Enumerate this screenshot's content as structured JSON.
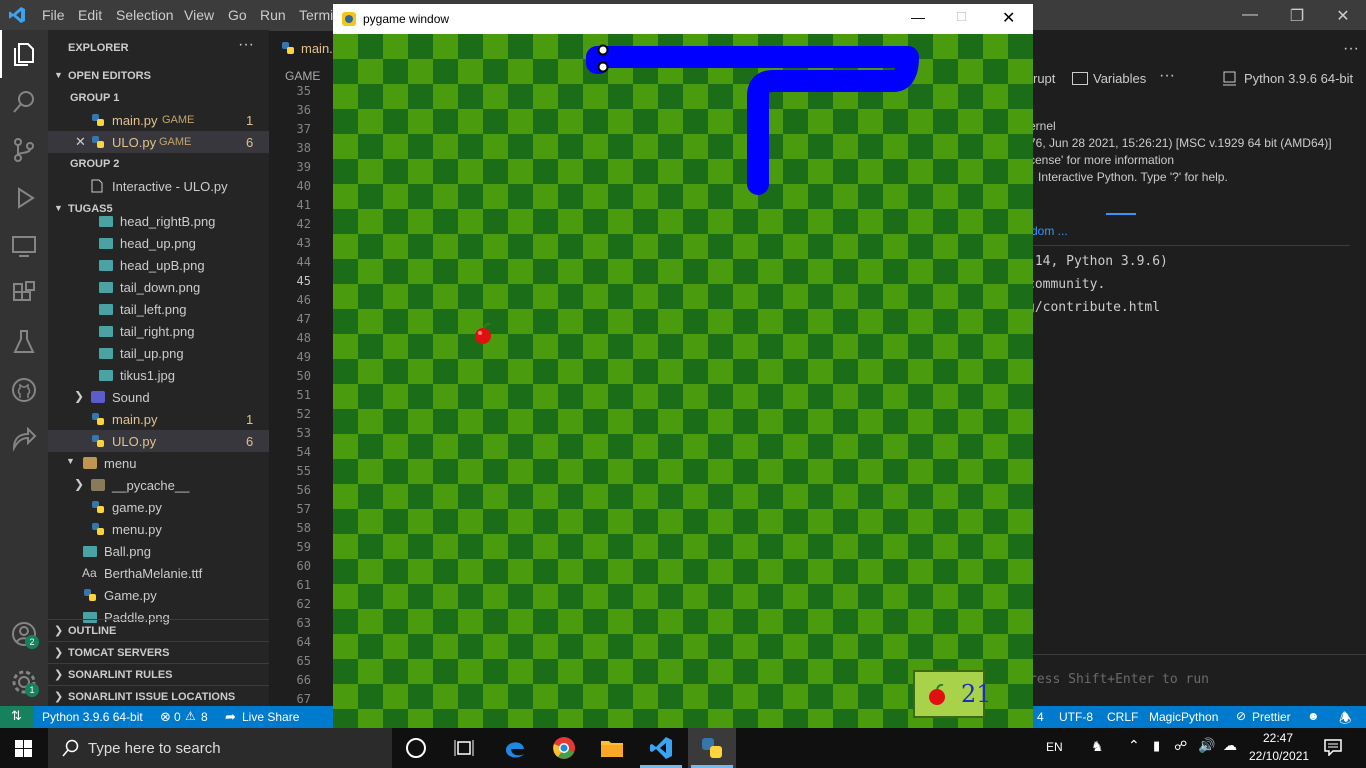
{
  "titlebar": {
    "menus": [
      "File",
      "Edit",
      "Selection",
      "View",
      "Go",
      "Run",
      "Termi"
    ]
  },
  "activity": {
    "accounts_badge": "2",
    "settings_badge": "1"
  },
  "sidebar": {
    "title": "EXPLORER",
    "open_editors": "OPEN EDITORS",
    "group1": "GROUP 1",
    "group1_files": [
      {
        "name": "main.py",
        "tag": "GAME",
        "count": "1"
      },
      {
        "name": "ULO.py",
        "tag": "GAME",
        "count": "6"
      }
    ],
    "group2": "GROUP 2",
    "group2_file": "Interactive - ULO.py",
    "project": "TUGAS5",
    "files": [
      "head_rightB.png",
      "head_up.png",
      "head_upB.png",
      "tail_down.png",
      "tail_left.png",
      "tail_right.png",
      "tail_up.png",
      "tikus1.jpg"
    ],
    "sound_folder": "Sound",
    "main_py": "main.py",
    "main_py_count": "1",
    "ulo_py": "ULO.py",
    "ulo_py_count": "6",
    "menu_folder": "menu",
    "pycache": "__pycache__",
    "game_py": "game.py",
    "menu_py": "menu.py",
    "ball_png": "Ball.png",
    "font_file": "BerthaMelanie.ttf",
    "font_prefix": "Aa",
    "game_py2": "Game.py",
    "paddle_png": "Paddle.png",
    "sections": [
      "OUTLINE",
      "TOMCAT SERVERS",
      "SONARLINT RULES",
      "SONARLINT ISSUE LOCATIONS"
    ]
  },
  "editor": {
    "tab": "main.",
    "breadcrumb": "GAME",
    "line_numbers": [
      "35",
      "36",
      "37",
      "38",
      "39",
      "40",
      "41",
      "42",
      "43",
      "44",
      "45",
      "46",
      "47",
      "48",
      "49",
      "50",
      "51",
      "52",
      "53",
      "54",
      "55",
      "56",
      "57",
      "58",
      "59",
      "60",
      "61",
      "62",
      "63",
      "64",
      "65",
      "66",
      "67"
    ],
    "current_line": "45"
  },
  "right_panel": {
    "toolbar_interrupt": "rupt",
    "toolbar_variables": "Variables",
    "kernel": "Python 3.9.6 64-bit",
    "info_lines": [
      "ernel",
      "76, Jun 28 2021, 15:26:21) [MSC v.1929 64 bit (AMD64)]",
      "cense' for more information",
      "Interactive Python. Type '?' for help."
    ],
    "link": "dom ...",
    "mono_lines": [
      ".14, Python 3.9.6)",
      " community.",
      "g/contribute.html"
    ],
    "input_hint": "ress Shift+Enter to run"
  },
  "pygame": {
    "title": "pygame window",
    "score": "21",
    "snake_color": "#0000ff",
    "light_tile": "#4a9c0e",
    "dark_tile": "#1c6d17"
  },
  "statusbar": {
    "python": "Python 3.9.6 64-bit",
    "errors": "0",
    "warnings": "8",
    "liveshare": "Live Share",
    "spaces": "4",
    "encoding": "UTF-8",
    "eol": "CRLF",
    "language": "MagicPython",
    "prettier": "Prettier"
  },
  "taskbar": {
    "search_placeholder": "Type here to search",
    "lang": "EN",
    "time": "22:47",
    "date": "22/10/2021"
  }
}
